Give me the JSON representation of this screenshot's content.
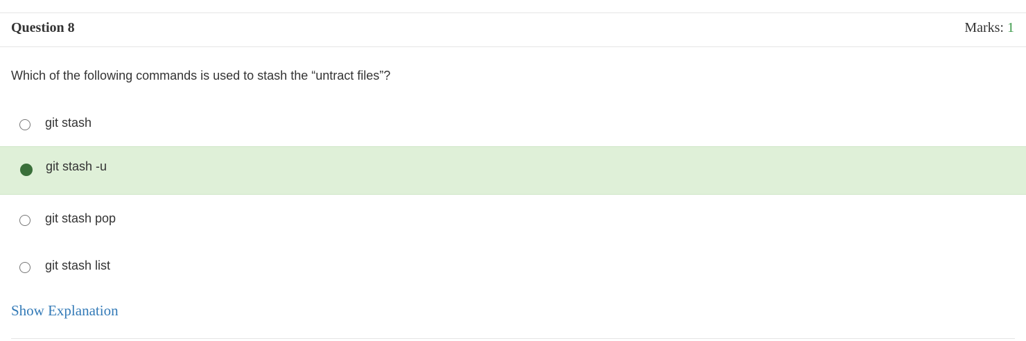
{
  "question": {
    "title": "Question 8",
    "marks_label": "Marks: ",
    "marks_value": "1",
    "text": "Which of the following commands is used to stash the “untract files”?"
  },
  "options": [
    {
      "label": "git stash",
      "selected": false
    },
    {
      "label": "git stash -u",
      "selected": true
    },
    {
      "label": "git stash pop",
      "selected": false
    },
    {
      "label": "git stash list",
      "selected": false
    }
  ],
  "footer": {
    "show_explanation_label": "Show Explanation"
  },
  "colors": {
    "selected_background": "#dff0d8",
    "selected_radio": "#3a6f3a",
    "marks_value": "#3c9a4a",
    "link": "#337ab7"
  }
}
